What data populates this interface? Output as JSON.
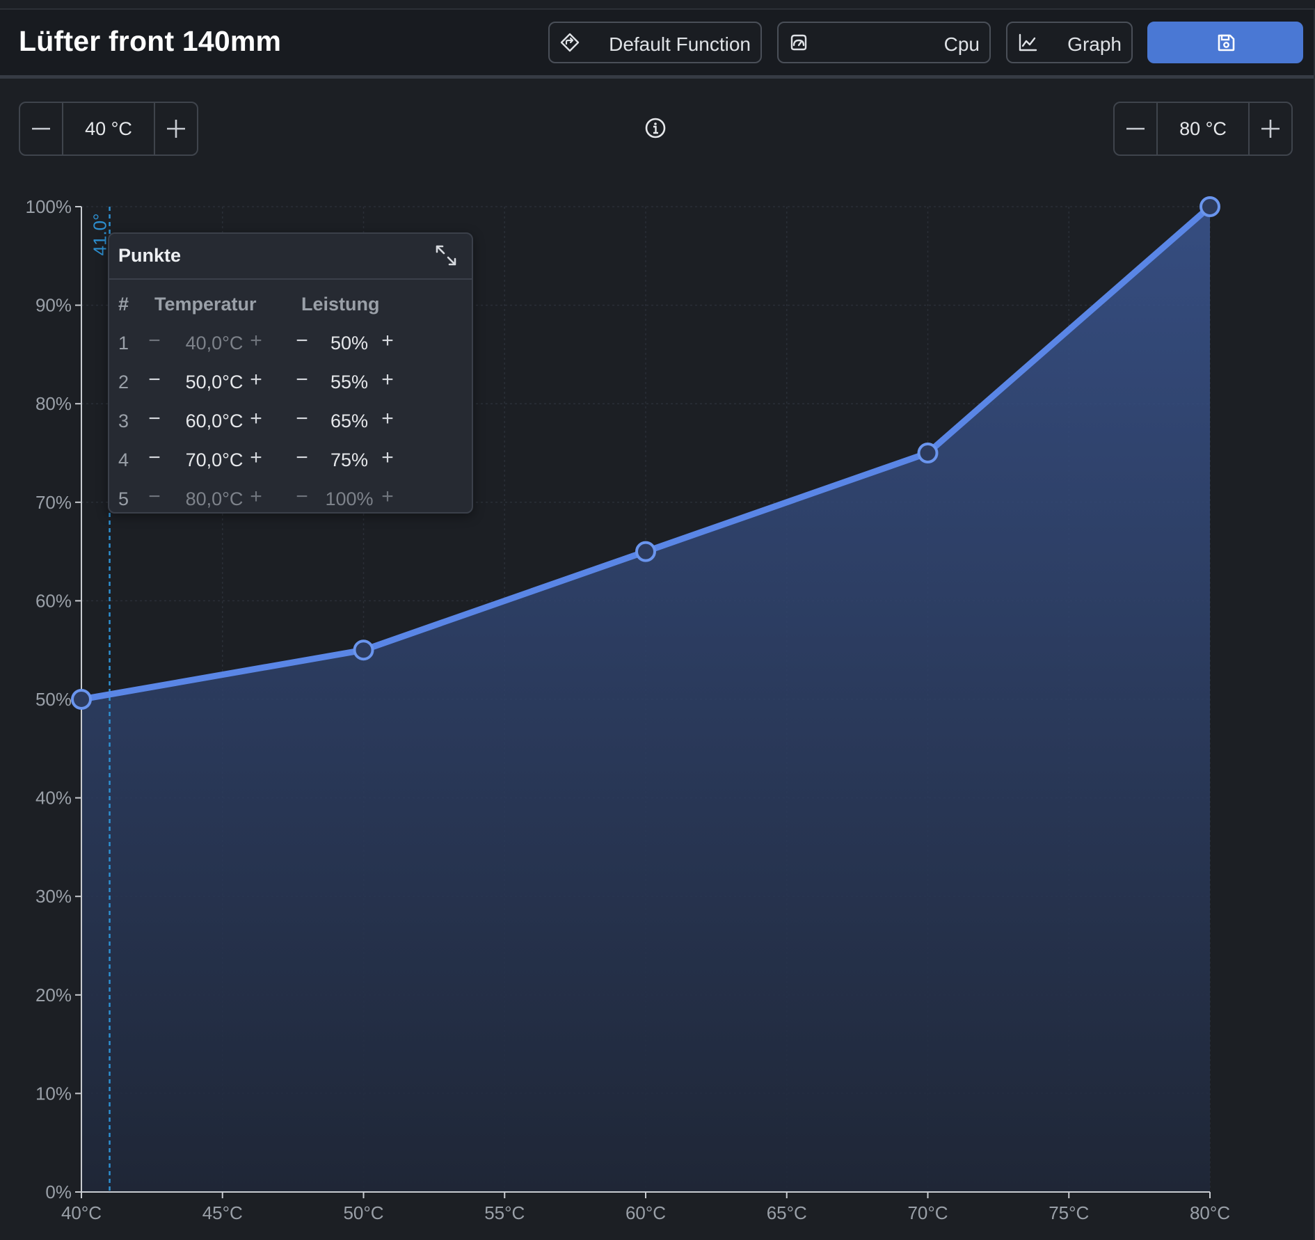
{
  "header": {
    "title": "Lüfter front 140mm",
    "function_label": "Default Function",
    "source_label": "Cpu",
    "graph_label": "Graph"
  },
  "range": {
    "min_value": "40 °C",
    "max_value": "80 °C"
  },
  "points_panel": {
    "title": "Punkte",
    "col_index": "#",
    "col_temp": "Temperatur",
    "col_power": "Leistung",
    "rows": [
      {
        "index": "1",
        "temp": "40,0°C",
        "power": "50%"
      },
      {
        "index": "2",
        "temp": "50,0°C",
        "power": "55%"
      },
      {
        "index": "3",
        "temp": "60,0°C",
        "power": "65%"
      },
      {
        "index": "4",
        "temp": "70,0°C",
        "power": "75%"
      },
      {
        "index": "5",
        "temp": "80,0°C",
        "power": "100%"
      }
    ]
  },
  "colors": {
    "accent": "#4a78d4",
    "line": "#5a86e6",
    "marker_line": "#2d8fd0"
  },
  "chart_data": {
    "type": "area",
    "x": [
      40,
      50,
      60,
      70,
      80
    ],
    "y": [
      50,
      55,
      65,
      75,
      100
    ],
    "xlim": [
      40,
      80
    ],
    "ylim": [
      0,
      100
    ],
    "x_ticks": [
      40,
      45,
      50,
      55,
      60,
      65,
      70,
      75,
      80
    ],
    "x_tick_labels": [
      "40°C",
      "45°C",
      "50°C",
      "55°C",
      "60°C",
      "65°C",
      "70°C",
      "75°C",
      "80°C"
    ],
    "y_ticks": [
      0,
      10,
      20,
      30,
      40,
      50,
      60,
      70,
      80,
      90,
      100
    ],
    "y_tick_labels": [
      "0%",
      "10%",
      "20%",
      "30%",
      "40%",
      "50%",
      "60%",
      "70%",
      "80%",
      "90%",
      "100%"
    ],
    "marker_x": 41,
    "marker_label": "41.0°",
    "grid": true
  }
}
